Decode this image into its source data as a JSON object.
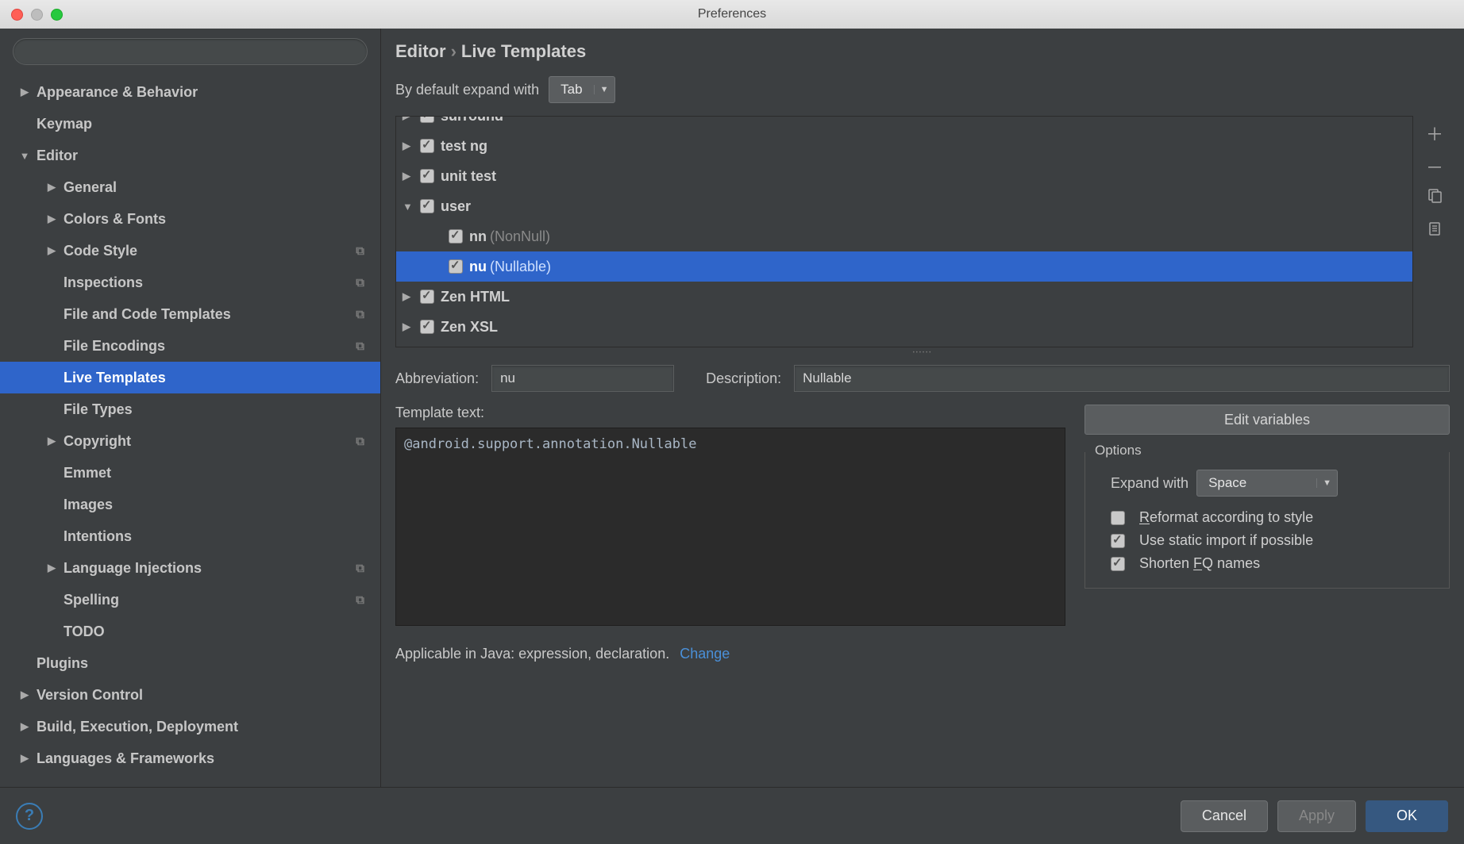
{
  "window": {
    "title": "Preferences"
  },
  "search": {
    "placeholder": ""
  },
  "sidebar": {
    "items": [
      {
        "label": "Appearance & Behavior",
        "arrow": "▶",
        "level": 0,
        "copy": false,
        "sel": false
      },
      {
        "label": "Keymap",
        "arrow": "",
        "level": 0,
        "copy": false,
        "sel": false
      },
      {
        "label": "Editor",
        "arrow": "▼",
        "level": 0,
        "copy": false,
        "sel": false
      },
      {
        "label": "General",
        "arrow": "▶",
        "level": 1,
        "copy": false,
        "sel": false
      },
      {
        "label": "Colors & Fonts",
        "arrow": "▶",
        "level": 1,
        "copy": false,
        "sel": false
      },
      {
        "label": "Code Style",
        "arrow": "▶",
        "level": 1,
        "copy": true,
        "sel": false
      },
      {
        "label": "Inspections",
        "arrow": "",
        "level": 1,
        "copy": true,
        "sel": false
      },
      {
        "label": "File and Code Templates",
        "arrow": "",
        "level": 1,
        "copy": true,
        "sel": false
      },
      {
        "label": "File Encodings",
        "arrow": "",
        "level": 1,
        "copy": true,
        "sel": false
      },
      {
        "label": "Live Templates",
        "arrow": "",
        "level": 1,
        "copy": false,
        "sel": true
      },
      {
        "label": "File Types",
        "arrow": "",
        "level": 1,
        "copy": false,
        "sel": false
      },
      {
        "label": "Copyright",
        "arrow": "▶",
        "level": 1,
        "copy": true,
        "sel": false
      },
      {
        "label": "Emmet",
        "arrow": "",
        "level": 1,
        "copy": false,
        "sel": false
      },
      {
        "label": "Images",
        "arrow": "",
        "level": 1,
        "copy": false,
        "sel": false
      },
      {
        "label": "Intentions",
        "arrow": "",
        "level": 1,
        "copy": false,
        "sel": false
      },
      {
        "label": "Language Injections",
        "arrow": "▶",
        "level": 1,
        "copy": true,
        "sel": false
      },
      {
        "label": "Spelling",
        "arrow": "",
        "level": 1,
        "copy": true,
        "sel": false
      },
      {
        "label": "TODO",
        "arrow": "",
        "level": 1,
        "copy": false,
        "sel": false
      },
      {
        "label": "Plugins",
        "arrow": "",
        "level": 0,
        "copy": false,
        "sel": false
      },
      {
        "label": "Version Control",
        "arrow": "▶",
        "level": 0,
        "copy": false,
        "sel": false
      },
      {
        "label": "Build, Execution, Deployment",
        "arrow": "▶",
        "level": 0,
        "copy": false,
        "sel": false
      },
      {
        "label": "Languages & Frameworks",
        "arrow": "▶",
        "level": 0,
        "copy": false,
        "sel": false
      }
    ]
  },
  "breadcrumb": {
    "parent": "Editor",
    "child": "Live Templates"
  },
  "expandDefault": {
    "label": "By default expand with",
    "value": "Tab"
  },
  "templateGroups": [
    {
      "arrow": "▶",
      "checked": true,
      "label": "surround",
      "level": 0,
      "sel": false,
      "hint": "",
      "cut": true
    },
    {
      "arrow": "▶",
      "checked": true,
      "label": "test ng",
      "level": 0,
      "sel": false,
      "hint": ""
    },
    {
      "arrow": "▶",
      "checked": true,
      "label": "unit test",
      "level": 0,
      "sel": false,
      "hint": ""
    },
    {
      "arrow": "▼",
      "checked": true,
      "label": "user",
      "level": 0,
      "sel": false,
      "hint": ""
    },
    {
      "arrow": "",
      "checked": true,
      "label": "nn",
      "level": 1,
      "sel": false,
      "hint": " (NonNull)"
    },
    {
      "arrow": "",
      "checked": true,
      "label": "nu",
      "level": 1,
      "sel": true,
      "hint": " (Nullable)"
    },
    {
      "arrow": "▶",
      "checked": true,
      "label": "Zen HTML",
      "level": 0,
      "sel": false,
      "hint": ""
    },
    {
      "arrow": "▶",
      "checked": true,
      "label": "Zen XSL",
      "level": 0,
      "sel": false,
      "hint": ""
    }
  ],
  "abbrev": {
    "label": "Abbreviation:",
    "value": "nu"
  },
  "desc": {
    "label": "Description:",
    "value": "Nullable"
  },
  "templateText": {
    "label": "Template text:",
    "value": "@android.support.annotation.Nullable"
  },
  "editVars": "Edit variables",
  "options": {
    "title": "Options",
    "expandLabel": "Expand with",
    "expandValue": "Space",
    "reformat": {
      "checked": false,
      "label_pre": "",
      "u": "R",
      "label_post": "eformat according to style"
    },
    "staticImport": {
      "checked": true,
      "label": "Use static import if possible"
    },
    "shorten": {
      "checked": true,
      "label_pre": "Shorten ",
      "u": "F",
      "label_post": "Q names"
    }
  },
  "applicable": {
    "text": "Applicable in Java: expression, declaration.",
    "link": "Change"
  },
  "footer": {
    "cancel": "Cancel",
    "apply": "Apply",
    "ok": "OK"
  }
}
